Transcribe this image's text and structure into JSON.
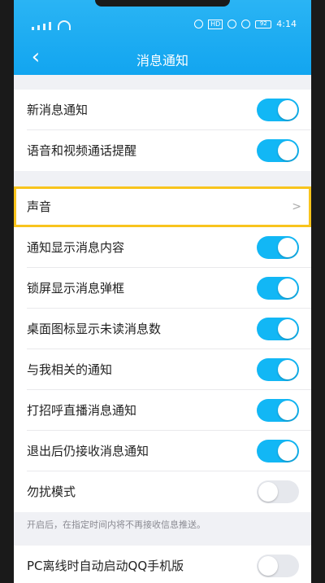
{
  "header": {
    "title": "消息通知",
    "back_icon": "back-arrow-icon"
  },
  "status_bar": {
    "battery": "92",
    "time": "4:14",
    "hd": "HD"
  },
  "section1": [
    {
      "label": "新消息通知",
      "on": true
    },
    {
      "label": "语音和视频通话提醒",
      "on": true
    }
  ],
  "sound": {
    "label": "声音"
  },
  "section2": [
    {
      "label": "通知显示消息内容",
      "on": true
    },
    {
      "label": "锁屏显示消息弹框",
      "on": true
    },
    {
      "label": "桌面图标显示未读消息数",
      "on": true
    },
    {
      "label": "与我相关的通知",
      "on": true
    },
    {
      "label": "打招呼直播消息通知",
      "on": true
    },
    {
      "label": "退出后仍接收消息通知",
      "on": true
    },
    {
      "label": "勿扰模式",
      "on": false
    }
  ],
  "dnd_hint": "开启后，在指定时间内将不再接收信息推送。",
  "section3": [
    {
      "label": "PC离线时自动启动QQ手机版",
      "on": false
    }
  ],
  "colors": {
    "accent": "#12b7f5",
    "header": "#12a5f0",
    "highlight": "#f8c41d"
  }
}
